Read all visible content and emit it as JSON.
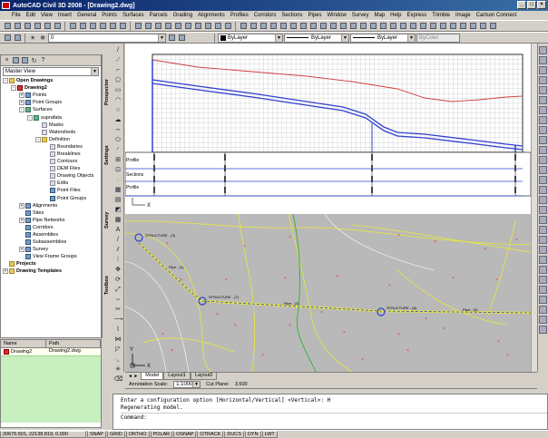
{
  "titlebar": {
    "title": "AutoCAD Civil 3D 2008 - [Drawing2.dwg]",
    "min": "_",
    "max": "□",
    "close": "×"
  },
  "menu": [
    "File",
    "Edit",
    "View",
    "Insert",
    "General",
    "Points",
    "Surfaces",
    "Parcels",
    "Grading",
    "Alignments",
    "Profiles",
    "Corridors",
    "Sections",
    "Pipes",
    "Window",
    "Survey",
    "Map",
    "Help",
    "Express",
    "Trimble",
    "Image",
    "Carlson Connect"
  ],
  "toolbar": {
    "layer_value": "0",
    "color": "ByLayer",
    "linetype": "ByLayer",
    "lineweight": "ByLayer",
    "plotstyle": "ByColor"
  },
  "prospector": {
    "view": "Master View",
    "tabs": [
      "Prospector",
      "Settings",
      "Survey",
      "Toolbox"
    ],
    "tree": [
      {
        "label": "Open Drawings",
        "depth": 0,
        "exp": "-",
        "icon": "folder"
      },
      {
        "label": "Drawing2",
        "depth": 1,
        "exp": "-",
        "icon": "dwg"
      },
      {
        "label": "Points",
        "depth": 2,
        "exp": "+",
        "icon": "item"
      },
      {
        "label": "Point Groups",
        "depth": 2,
        "exp": "+",
        "icon": "item"
      },
      {
        "label": "Surfaces",
        "depth": 2,
        "exp": "-",
        "icon": "surf"
      },
      {
        "label": "suprafata",
        "depth": 3,
        "exp": "-",
        "icon": "surf"
      },
      {
        "label": "Masks",
        "depth": 4,
        "exp": "",
        "icon": "leaf"
      },
      {
        "label": "Watersheds",
        "depth": 4,
        "exp": "",
        "icon": "leaf"
      },
      {
        "label": "Definition",
        "depth": 4,
        "exp": "-",
        "icon": "folder"
      },
      {
        "label": "Boundaries",
        "depth": 5,
        "exp": "",
        "icon": "leaf"
      },
      {
        "label": "Breaklines",
        "depth": 5,
        "exp": "",
        "icon": "leaf"
      },
      {
        "label": "Contours",
        "depth": 5,
        "exp": "",
        "icon": "leaf"
      },
      {
        "label": "DEM Files",
        "depth": 5,
        "exp": "",
        "icon": "leaf"
      },
      {
        "label": "Drawing Objects",
        "depth": 5,
        "exp": "",
        "icon": "leaf"
      },
      {
        "label": "Edits",
        "depth": 5,
        "exp": "",
        "icon": "leaf"
      },
      {
        "label": "Point Files",
        "depth": 5,
        "exp": "",
        "icon": "item"
      },
      {
        "label": "Point Groups",
        "depth": 5,
        "exp": "",
        "icon": "item"
      },
      {
        "label": "Alignments",
        "depth": 2,
        "exp": "+",
        "icon": "item"
      },
      {
        "label": "Sites",
        "depth": 2,
        "exp": "",
        "icon": "item"
      },
      {
        "label": "Pipe Networks",
        "depth": 2,
        "exp": "+",
        "icon": "item"
      },
      {
        "label": "Corridors",
        "depth": 2,
        "exp": "",
        "icon": "item"
      },
      {
        "label": "Assemblies",
        "depth": 2,
        "exp": "",
        "icon": "item"
      },
      {
        "label": "Subassemblies",
        "depth": 2,
        "exp": "",
        "icon": "item"
      },
      {
        "label": "Survey",
        "depth": 2,
        "exp": "+",
        "icon": "item"
      },
      {
        "label": "View Frame Groups",
        "depth": 2,
        "exp": "",
        "icon": "item"
      },
      {
        "label": "Projects",
        "depth": 0,
        "exp": "",
        "icon": "folder"
      },
      {
        "label": "Drawing Templates",
        "depth": 0,
        "exp": "+",
        "icon": "folder"
      }
    ]
  },
  "listview": {
    "col_name": "Name",
    "col_path": "Path",
    "row_name": "Drawing2",
    "row_path": "Drawing2.dwg"
  },
  "drawing": {
    "band_labels": [
      "Profile",
      "Sections",
      "Profile"
    ],
    "struct_labels": [
      "STRUCTURE - (3)",
      "STRUCTURE - (7)",
      "STRUCTURE - (8)"
    ],
    "pipe_labels": [
      "Pipe - (1)",
      "Pipe - (2)",
      "Pipe - (3)"
    ],
    "axis_x": "X",
    "axis_y": "Y"
  },
  "layout_tabs": [
    "Model",
    "Layout1",
    "Layout2"
  ],
  "annotation": {
    "scale_label": "Annotation Scale:",
    "scale_value": "1:1000",
    "cut_label": "Cut Plane:",
    "cut_value": "3.500"
  },
  "command": {
    "line1": "Enter a configuration option [Horizontal/Vertical] <Vertical>: H",
    "line2": "Regenerating model.",
    "prompt": "Command:"
  },
  "status": {
    "coords": "20675.501, 22138.819, 0.000",
    "toggles": [
      "SNAP",
      "GRID",
      "ORTHO",
      "POLAR",
      "OSNAP",
      "OTRACK",
      "DUCS",
      "DYN",
      "LWT"
    ]
  }
}
